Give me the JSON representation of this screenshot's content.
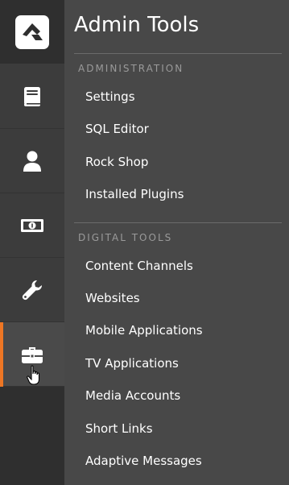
{
  "panel": {
    "title": "Admin Tools",
    "sections": [
      {
        "header": "ADMINISTRATION",
        "items": [
          "Settings",
          "SQL Editor",
          "Rock Shop",
          "Installed Plugins"
        ]
      },
      {
        "header": "DIGITAL TOOLS",
        "items": [
          "Content Channels",
          "Websites",
          "Mobile Applications",
          "TV Applications",
          "Media Accounts",
          "Short Links",
          "Adaptive Messages"
        ]
      }
    ]
  },
  "rail": {
    "logo_icon": "rock-logo-icon",
    "items": [
      {
        "icon": "book-icon",
        "active": false
      },
      {
        "icon": "person-icon",
        "active": false
      },
      {
        "icon": "money-icon",
        "active": false
      },
      {
        "icon": "wrench-icon",
        "active": false
      },
      {
        "icon": "briefcase-icon",
        "active": true
      }
    ]
  },
  "colors": {
    "accent": "#ee7624",
    "rail_bg": "#3c3c3c",
    "panel_bg": "#484848",
    "text": "#ffffff",
    "section_header": "#9a9a9a"
  }
}
